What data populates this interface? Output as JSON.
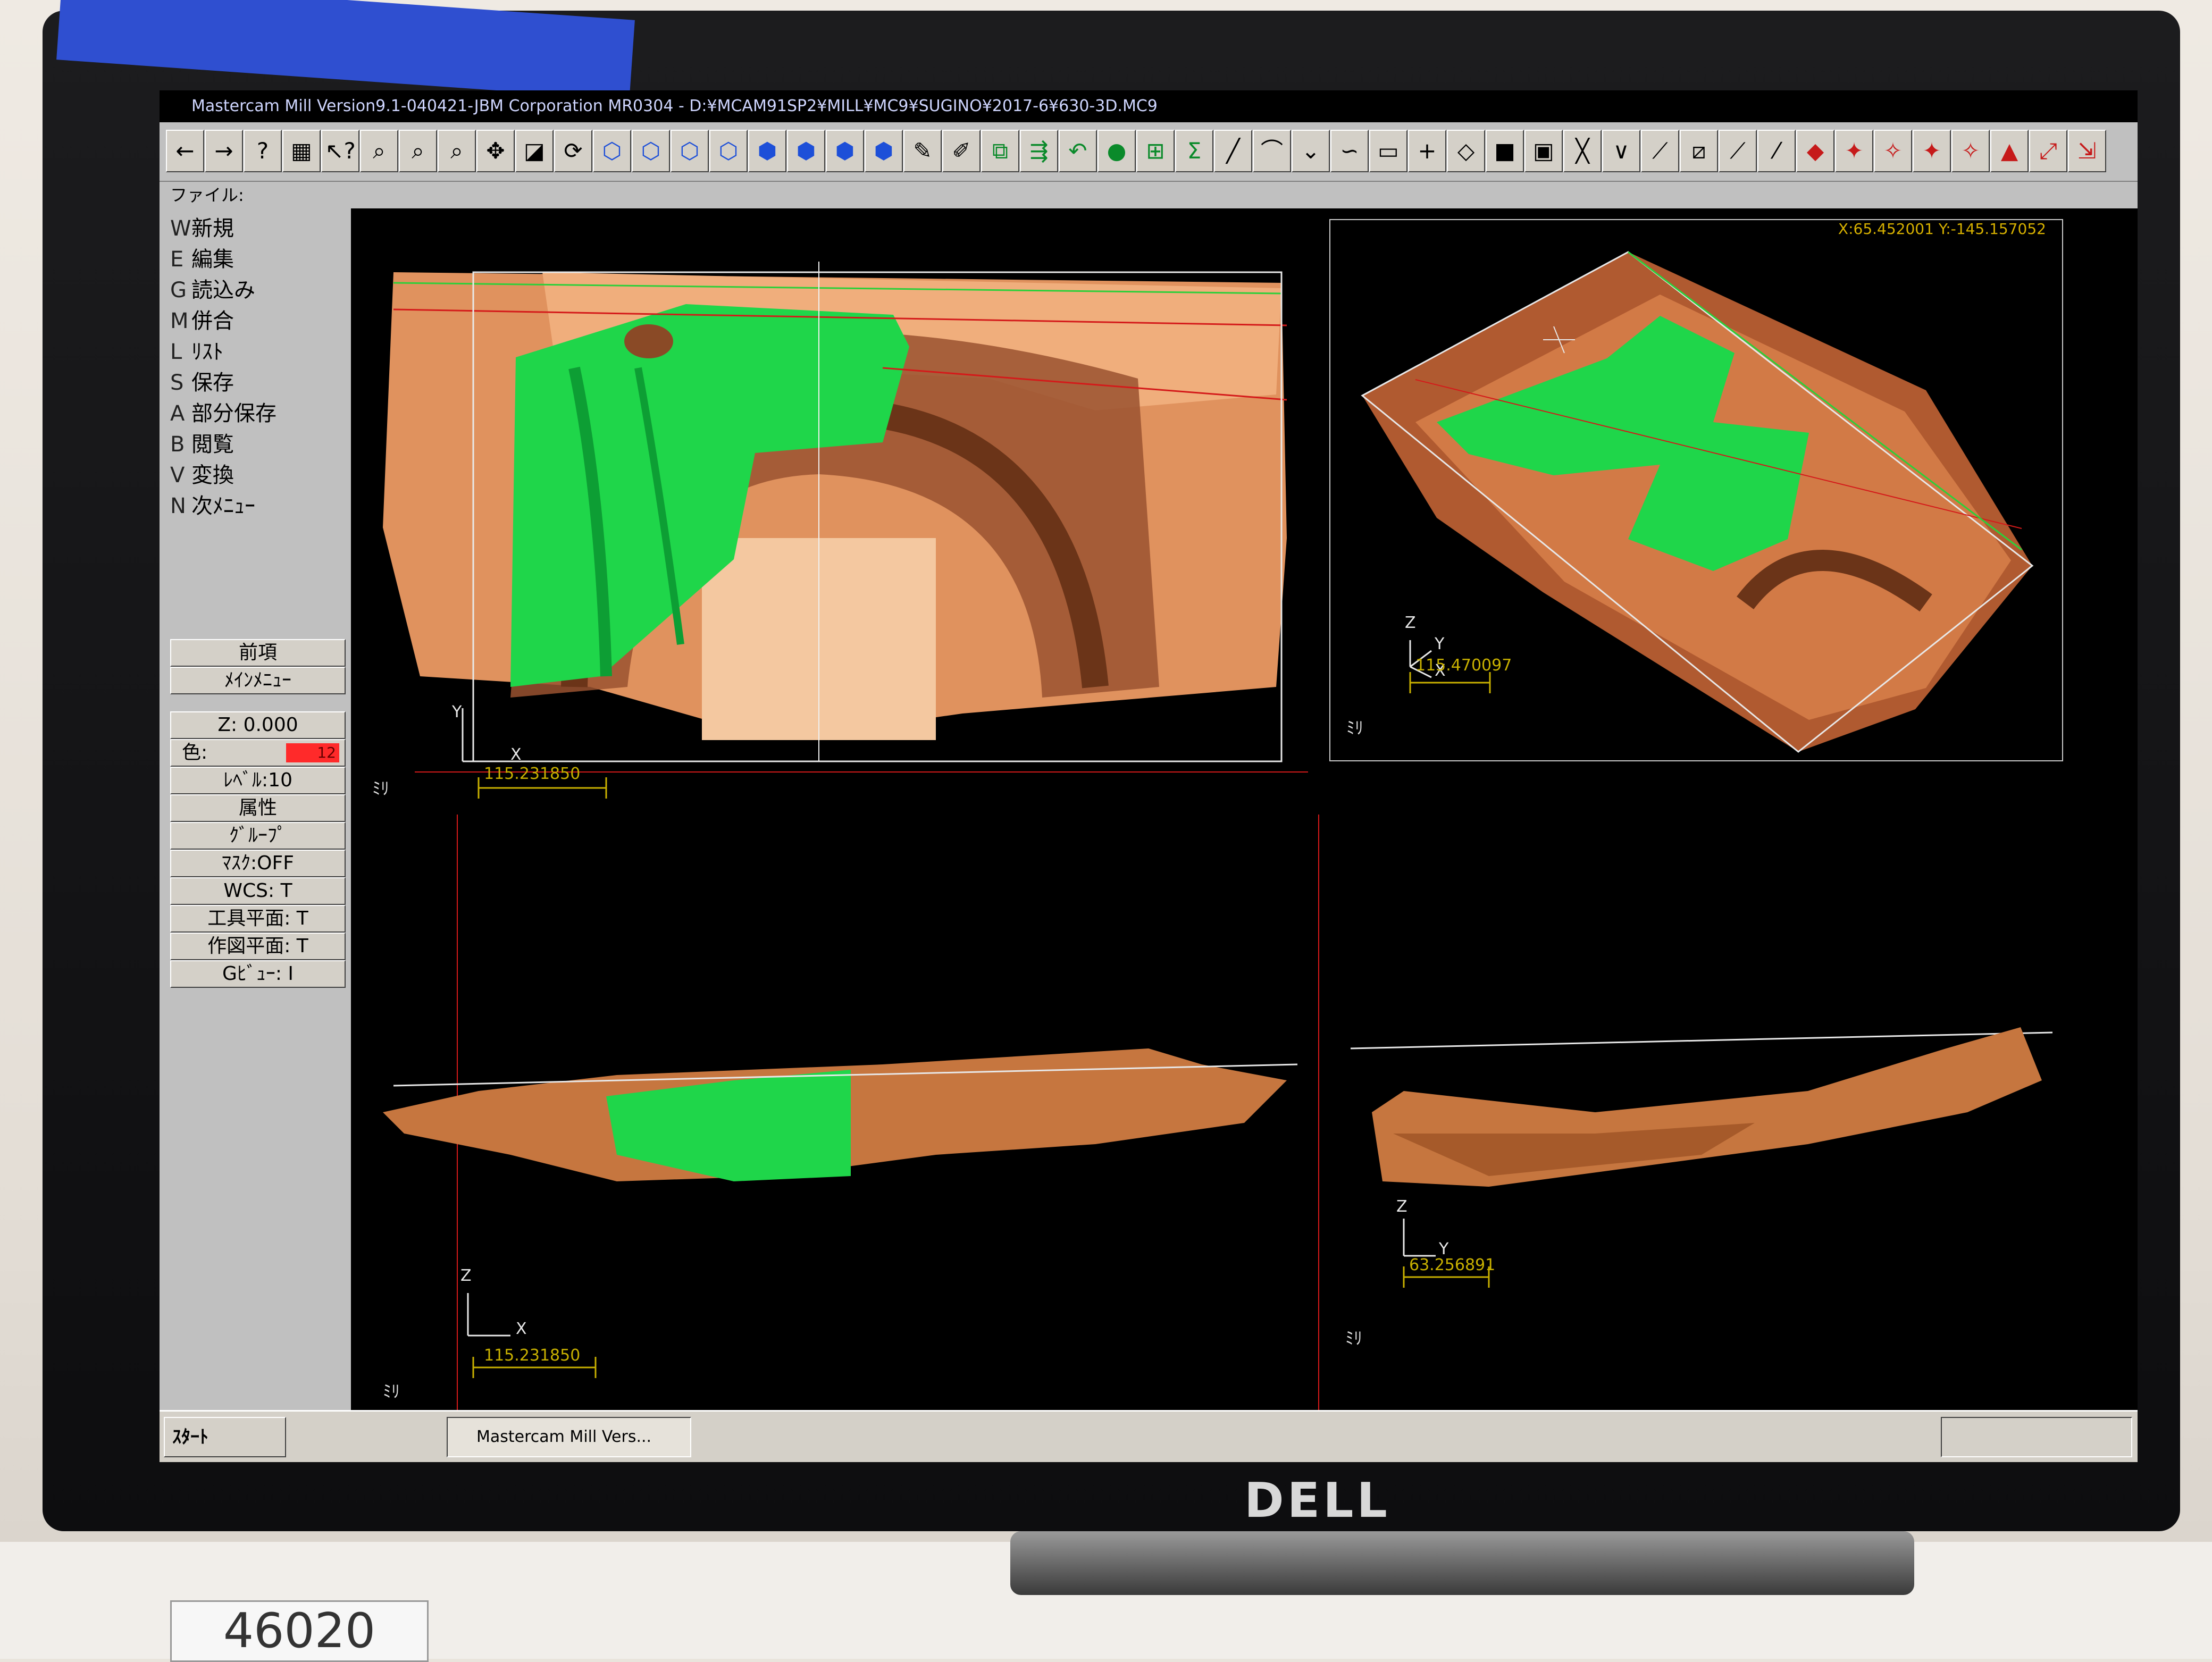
{
  "window": {
    "title": "Mastercam Mill Version9.1-040421-JBM Corporation MR0304 - D:¥MCAM91SP2¥MILL¥MC9¥SUGINO¥2017-6¥630-3D.MC9"
  },
  "menubar": {
    "label": "ファイル:"
  },
  "toolbar": {
    "buttons": [
      {
        "name": "back-arrow-icon",
        "glyph": "←"
      },
      {
        "name": "forward-arrow-icon",
        "glyph": "→"
      },
      {
        "name": "help-icon",
        "glyph": "?"
      },
      {
        "name": "calculator-icon",
        "glyph": "▦"
      },
      {
        "name": "context-help-icon",
        "glyph": "↖?"
      },
      {
        "name": "zoom-window-icon",
        "glyph": "⌕"
      },
      {
        "name": "zoom-out-icon",
        "glyph": "⌕"
      },
      {
        "name": "zoom-in-icon",
        "glyph": "⌕"
      },
      {
        "name": "pan-icon",
        "glyph": "✥"
      },
      {
        "name": "select-icon",
        "glyph": "◪"
      },
      {
        "name": "rotate-icon",
        "glyph": "⟳"
      },
      {
        "name": "view-top-icon",
        "glyph": "⬡"
      },
      {
        "name": "view-front-icon",
        "glyph": "⬡"
      },
      {
        "name": "view-side-icon",
        "glyph": "⬡"
      },
      {
        "name": "view-iso-icon",
        "glyph": "⬡"
      },
      {
        "name": "cube-1-icon",
        "glyph": "⬢"
      },
      {
        "name": "cube-2-icon",
        "glyph": "⬢"
      },
      {
        "name": "cube-3-icon",
        "glyph": "⬢"
      },
      {
        "name": "cube-4-icon",
        "glyph": "⬢"
      },
      {
        "name": "pencil-icon",
        "glyph": "✎"
      },
      {
        "name": "eraser-icon",
        "glyph": "✐"
      },
      {
        "name": "screen-icon",
        "glyph": "⧉"
      },
      {
        "name": "toolpath-icon",
        "glyph": "⇶"
      },
      {
        "name": "undo-icon",
        "glyph": "↶"
      },
      {
        "name": "sphere-icon",
        "glyph": "●"
      },
      {
        "name": "layers-icon",
        "glyph": "⊞"
      },
      {
        "name": "sigma-icon",
        "glyph": "Σ"
      },
      {
        "name": "line-icon",
        "glyph": "╱"
      },
      {
        "name": "arc-icon",
        "glyph": "⌒"
      },
      {
        "name": "chevron-icon",
        "glyph": "⌄"
      },
      {
        "name": "spline-icon",
        "glyph": "∽"
      },
      {
        "name": "rectangle-icon",
        "glyph": "▭"
      },
      {
        "name": "plus-icon",
        "glyph": "+"
      },
      {
        "name": "surface-icon",
        "glyph": "◇"
      },
      {
        "name": "solid-icon",
        "glyph": "■"
      },
      {
        "name": "box-icon",
        "glyph": "▣"
      },
      {
        "name": "trim-1-icon",
        "glyph": "╳"
      },
      {
        "name": "trim-2-icon",
        "glyph": "∨"
      },
      {
        "name": "trim-3-icon",
        "glyph": "⟋"
      },
      {
        "name": "trim-4-icon",
        "glyph": "⧄"
      },
      {
        "name": "trim-5-icon",
        "glyph": "⟋"
      },
      {
        "name": "offset-icon",
        "glyph": "⁄"
      },
      {
        "name": "op-1-icon",
        "glyph": "◆"
      },
      {
        "name": "op-2-icon",
        "glyph": "✦"
      },
      {
        "name": "op-3-icon",
        "glyph": "✧"
      },
      {
        "name": "op-4-icon",
        "glyph": "✦"
      },
      {
        "name": "op-5-icon",
        "glyph": "✧"
      },
      {
        "name": "op-6-icon",
        "glyph": "▲"
      },
      {
        "name": "op-7-icon",
        "glyph": "⤢"
      },
      {
        "name": "op-8-icon",
        "glyph": "⇲"
      }
    ]
  },
  "sidemenu": {
    "items": [
      {
        "key": "W",
        "label": "新規"
      },
      {
        "key": "E",
        "label": "編集"
      },
      {
        "key": "G",
        "label": "読込み"
      },
      {
        "key": "M",
        "label": "併合"
      },
      {
        "key": "L",
        "label": "ﾘｽﾄ"
      },
      {
        "key": "S",
        "label": "保存"
      },
      {
        "key": "A",
        "label": "部分保存"
      },
      {
        "key": "B",
        "label": "閲覧"
      },
      {
        "key": "V",
        "label": "変換"
      },
      {
        "key": "N",
        "label": "次ﾒﾆｭｰ"
      }
    ],
    "prev": "前項",
    "main_menu": "ﾒｲﾝﾒﾆｭｰ",
    "z": "Z:   0.000",
    "color_label": "色:",
    "color_value": "12",
    "level": "ﾚﾍﾞﾙ:10",
    "attributes": "属性",
    "group": "ｸﾞﾙｰﾌﾟ",
    "mask": "ﾏｽｸ:OFF",
    "wcs": "WCS:   T",
    "tool_plane": "工具平面:  T",
    "const_plane": "作図平面:  T",
    "gview": "Gﾋﾞｭｰ:   I"
  },
  "viewports": {
    "top": {
      "scale": "115.231850",
      "mm": "ﾐﾘ",
      "axis_y": "Y",
      "axis_x": "X"
    },
    "iso": {
      "scale": "115.470097",
      "mm": "ﾐﾘ",
      "axis_z": "Z",
      "axis_y": "Y",
      "axis_x": "X",
      "coords": "X:65.452001  Y:-145.157052"
    },
    "front": {
      "scale": "115.231850",
      "mm": "ﾐﾘ",
      "axis_z": "Z",
      "axis_x": "X"
    },
    "side": {
      "scale": "63.256891",
      "mm": "ﾐﾘ",
      "axis_z": "Z",
      "axis_y": "Y"
    }
  },
  "colors": {
    "part": "#e09060",
    "part_dark": "#8a4a26",
    "selected": "#1fd64a",
    "wire_red": "#d41a1a",
    "wire_green": "#2bd03a",
    "scale": "#c8b000"
  },
  "taskbar": {
    "start": "ｽﾀｰﾄ",
    "task": "Mastercam Mill Vers..."
  },
  "brand": {
    "logo": "DELL"
  },
  "sticker": {
    "number": "46020"
  }
}
